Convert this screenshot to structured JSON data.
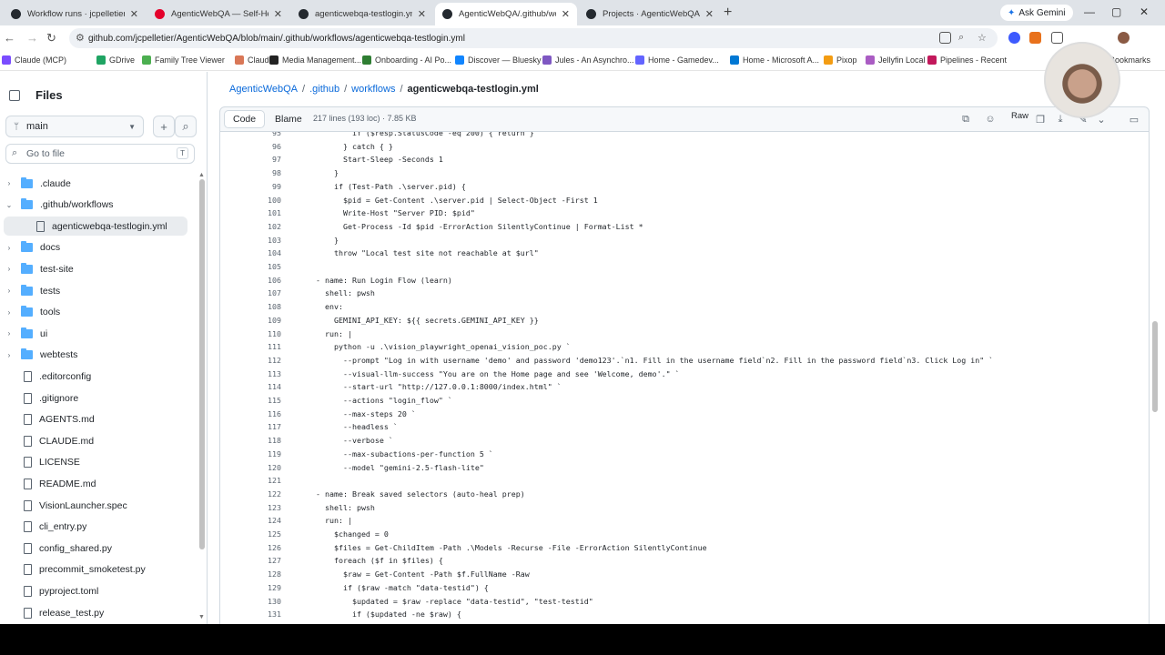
{
  "browser": {
    "tabs": [
      {
        "title": "Workflow runs · jcpelletier/Spa",
        "color": "#24292f",
        "active": false
      },
      {
        "title": "AgenticWebQA — Self-Healing",
        "color": "#e4002b",
        "active": false
      },
      {
        "title": "agenticwebqa-testlogin.yml · jcpellet",
        "color": "#24292f",
        "active": false
      },
      {
        "title": "AgenticWebQA/.github/workflo",
        "color": "#24292f",
        "active": true
      },
      {
        "title": "Projects · AgenticWebQA",
        "color": "#24292f",
        "active": false
      }
    ],
    "new_tab": "+",
    "ask_gemini": "Ask Gemini",
    "window": {
      "minimize": "—",
      "maximize": "▢",
      "close": "✕"
    },
    "url": "github.com/jcpelletier/AgenticWebQA/blob/main/.github/workflows/agenticwebqa-testlogin.yml",
    "nav": {
      "back": "←",
      "forward": "→",
      "reload": "↻"
    },
    "bookmarks": [
      {
        "label": "Claude (MCP)",
        "color": "#7a4cff"
      },
      {
        "label": "GDrive",
        "color": "#1fa463"
      },
      {
        "label": "Family Tree Viewer",
        "color": "#4caf50"
      },
      {
        "label": "Claude",
        "color": "#d97757"
      },
      {
        "label": "Media Management...",
        "color": "#222"
      },
      {
        "label": "Onboarding - AI Po...",
        "color": "#2e7d32"
      },
      {
        "label": "Discover — Bluesky",
        "color": "#1185fe"
      },
      {
        "label": "Jules - An Asynchro...",
        "color": "#7e57c2"
      },
      {
        "label": "Home - Gamedev...",
        "color": "#6364ff"
      },
      {
        "label": "Home - Microsoft A...",
        "color": "#0078d4"
      },
      {
        "label": "Pixop",
        "color": "#f39c12"
      },
      {
        "label": "Jellyfin Local",
        "color": "#aa5cc3"
      },
      {
        "label": "Pipelines - Recent",
        "color": "#c2185b"
      },
      {
        "label": "Bookmarks",
        "color": "#fbc02d"
      }
    ]
  },
  "sidebar": {
    "title": "Files",
    "branch": "main",
    "search_placeholder": "Go to file",
    "search_shortcut": "T",
    "items": [
      {
        "label": ".claude",
        "type": "folder",
        "chev": "›",
        "indent": 0
      },
      {
        "label": ".github/workflows",
        "type": "folder",
        "chev": "⌄",
        "indent": 0
      },
      {
        "label": "agenticwebqa-testlogin.yml",
        "type": "file",
        "chev": "",
        "indent": 1,
        "selected": true
      },
      {
        "label": "docs",
        "type": "folder",
        "chev": "›",
        "indent": 0
      },
      {
        "label": "test-site",
        "type": "folder",
        "chev": "›",
        "indent": 0
      },
      {
        "label": "tests",
        "type": "folder",
        "chev": "›",
        "indent": 0
      },
      {
        "label": "tools",
        "type": "folder",
        "chev": "›",
        "indent": 0
      },
      {
        "label": "ui",
        "type": "folder",
        "chev": "›",
        "indent": 0
      },
      {
        "label": "webtests",
        "type": "folder",
        "chev": "›",
        "indent": 0
      },
      {
        "label": ".editorconfig",
        "type": "file",
        "chev": "",
        "indent": 0
      },
      {
        "label": ".gitignore",
        "type": "file",
        "chev": "",
        "indent": 0
      },
      {
        "label": "AGENTS.md",
        "type": "file",
        "chev": "",
        "indent": 0
      },
      {
        "label": "CLAUDE.md",
        "type": "file",
        "chev": "",
        "indent": 0
      },
      {
        "label": "LICENSE",
        "type": "file",
        "chev": "",
        "indent": 0
      },
      {
        "label": "README.md",
        "type": "file",
        "chev": "",
        "indent": 0
      },
      {
        "label": "VisionLauncher.spec",
        "type": "file",
        "chev": "",
        "indent": 0
      },
      {
        "label": "cli_entry.py",
        "type": "file",
        "chev": "",
        "indent": 0
      },
      {
        "label": "config_shared.py",
        "type": "file",
        "chev": "",
        "indent": 0
      },
      {
        "label": "precommit_smoketest.py",
        "type": "file",
        "chev": "",
        "indent": 0
      },
      {
        "label": "pyproject.toml",
        "type": "file",
        "chev": "",
        "indent": 0
      },
      {
        "label": "release_test.py",
        "type": "file",
        "chev": "",
        "indent": 0
      }
    ]
  },
  "breadcrumb": {
    "parts": [
      "AgenticWebQA",
      ".github",
      "workflows"
    ],
    "separator": "/",
    "current": "agenticwebqa-testlogin.yml"
  },
  "file": {
    "code_tab": "Code",
    "blame_tab": "Blame",
    "info": "217 lines (193 loc) · 7.85 KB",
    "raw_label": "Raw"
  },
  "code_lines": [
    {
      "n": "95",
      "t": "          if ($resp.StatusCode -eq 200) { return }"
    },
    {
      "n": "96",
      "t": "        } catch { }"
    },
    {
      "n": "97",
      "t": "        Start-Sleep -Seconds 1"
    },
    {
      "n": "98",
      "t": "      }"
    },
    {
      "n": "99",
      "t": "      if (Test-Path .\\server.pid) {"
    },
    {
      "n": "100",
      "t": "        $pid = Get-Content .\\server.pid | Select-Object -First 1"
    },
    {
      "n": "101",
      "t": "        Write-Host \"Server PID: $pid\""
    },
    {
      "n": "102",
      "t": "        Get-Process -Id $pid -ErrorAction SilentlyContinue | Format-List *"
    },
    {
      "n": "103",
      "t": "      }"
    },
    {
      "n": "104",
      "t": "      throw \"Local test site not reachable at $url\""
    },
    {
      "n": "105",
      "t": ""
    },
    {
      "n": "106",
      "t": "  - name: Run Login Flow (learn)"
    },
    {
      "n": "107",
      "t": "    shell: pwsh"
    },
    {
      "n": "108",
      "t": "    env:"
    },
    {
      "n": "109",
      "t": "      GEMINI_API_KEY: ${{ secrets.GEMINI_API_KEY }}"
    },
    {
      "n": "110",
      "t": "    run: |"
    },
    {
      "n": "111",
      "t": "      python -u .\\vision_playwright_openai_vision_poc.py `"
    },
    {
      "n": "112",
      "t": "        --prompt \"Log in with username 'demo' and password 'demo123'.`n1. Fill in the username field`n2. Fill in the password field`n3. Click Log in\" `"
    },
    {
      "n": "113",
      "t": "        --visual-llm-success \"You are on the Home page and see 'Welcome, demo'.\" `"
    },
    {
      "n": "114",
      "t": "        --start-url \"http://127.0.0.1:8000/index.html\" `"
    },
    {
      "n": "115",
      "t": "        --actions \"login_flow\" `"
    },
    {
      "n": "116",
      "t": "        --max-steps 20 `"
    },
    {
      "n": "117",
      "t": "        --headless `"
    },
    {
      "n": "118",
      "t": "        --verbose `"
    },
    {
      "n": "119",
      "t": "        --max-subactions-per-function 5 `"
    },
    {
      "n": "120",
      "t": "        --model \"gemini-2.5-flash-lite\""
    },
    {
      "n": "121",
      "t": ""
    },
    {
      "n": "122",
      "t": "  - name: Break saved selectors (auto-heal prep)"
    },
    {
      "n": "123",
      "t": "    shell: pwsh"
    },
    {
      "n": "124",
      "t": "    run: |"
    },
    {
      "n": "125",
      "t": "      $changed = 0"
    },
    {
      "n": "126",
      "t": "      $files = Get-ChildItem -Path .\\Models -Recurse -File -ErrorAction SilentlyContinue"
    },
    {
      "n": "127",
      "t": "      foreach ($f in $files) {"
    },
    {
      "n": "128",
      "t": "        $raw = Get-Content -Path $f.FullName -Raw"
    },
    {
      "n": "129",
      "t": "        if ($raw -match \"data-testid\") {"
    },
    {
      "n": "130",
      "t": "          $updated = $raw -replace \"data-testid\", \"test-testid\""
    },
    {
      "n": "131",
      "t": "          if ($updated -ne $raw) {"
    }
  ]
}
